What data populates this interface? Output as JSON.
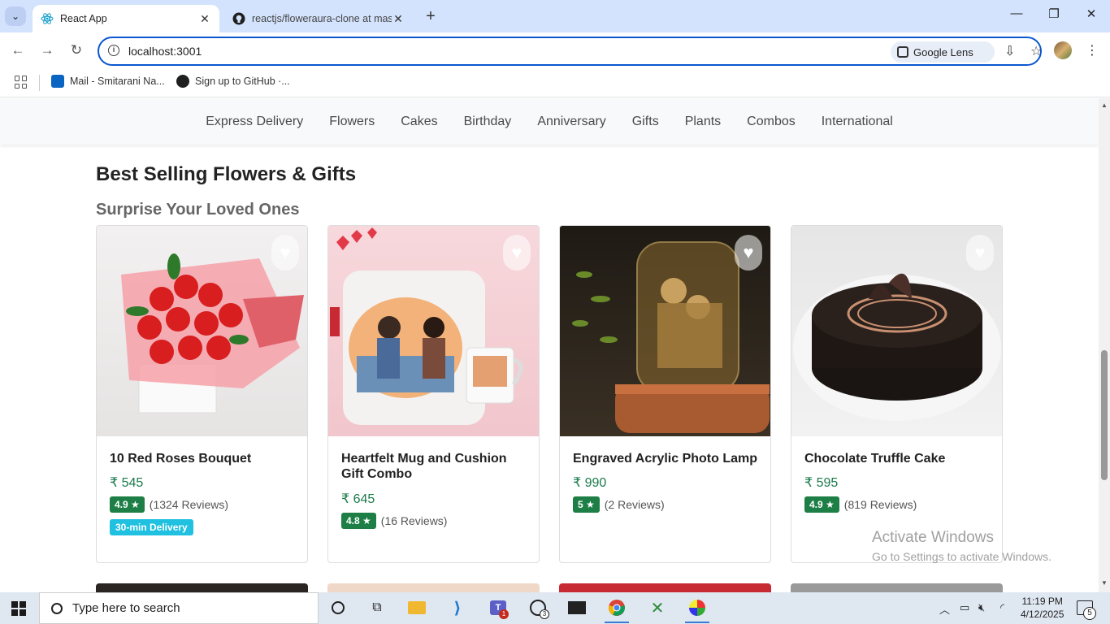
{
  "browser": {
    "tabs": [
      {
        "title": "React App",
        "active": true
      },
      {
        "title": "reactjs/floweraura-clone at mas",
        "active": false
      }
    ],
    "url": "localhost:3001",
    "lens_label": "Google Lens",
    "bookmarks": [
      {
        "label": "Mail - Smitarani Na..."
      },
      {
        "label": "Sign up to GitHub ·..."
      }
    ]
  },
  "nav": {
    "links": [
      "Express Delivery",
      "Flowers",
      "Cakes",
      "Birthday",
      "Anniversary",
      "Gifts",
      "Plants",
      "Combos",
      "International"
    ]
  },
  "section": {
    "title": "Best Selling Flowers & Gifts",
    "subtitle": "Surprise Your Loved Ones"
  },
  "products": [
    {
      "name": "10 Red Roses Bouquet",
      "price": "₹ 545",
      "rating": "4.9 ★",
      "reviews": "(1324 Reviews)",
      "tag": "30-min Delivery"
    },
    {
      "name": "Heartfelt Mug and Cushion Gift Combo",
      "price": "₹ 645",
      "rating": "4.8 ★",
      "reviews": "(16 Reviews)",
      "tag": ""
    },
    {
      "name": "Engraved Acrylic Photo Lamp",
      "price": "₹ 990",
      "rating": "5 ★",
      "reviews": "(2 Reviews)",
      "tag": ""
    },
    {
      "name": "Chocolate Truffle Cake",
      "price": "₹ 595",
      "rating": "4.9 ★",
      "reviews": "(819 Reviews)",
      "tag": ""
    }
  ],
  "watermark": {
    "line1": "Activate Windows",
    "line2": "Go to Settings to activate Windows."
  },
  "taskbar": {
    "search_placeholder": "Type here to search",
    "time": "11:19 PM",
    "date": "4/12/2025",
    "teams_badge": "1",
    "whatsapp_badge": "3",
    "notification_count": "5"
  },
  "colors": {
    "accent": "#0b57d0",
    "rating_badge": "#1d7f45",
    "price": "#1a7a4a",
    "delivery_tag": "#1fc0e0"
  }
}
